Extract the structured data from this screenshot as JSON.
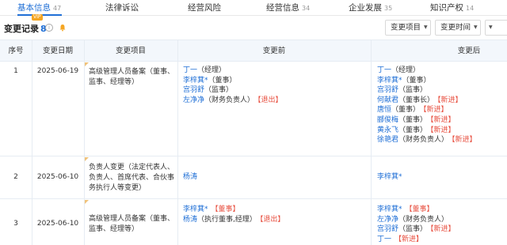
{
  "tabs": [
    {
      "label": "基本信息",
      "count": "47",
      "active": true
    },
    {
      "label": "法律诉讼",
      "count": "",
      "active": false
    },
    {
      "label": "经营风险",
      "count": "",
      "active": false
    },
    {
      "label": "经营信息",
      "count": "34",
      "active": false
    },
    {
      "label": "企业发展",
      "count": "35",
      "active": false
    },
    {
      "label": "知识产权",
      "count": "14",
      "active": false
    }
  ],
  "vip_badge": "VIP",
  "section": {
    "title": "变更记录",
    "count": "8"
  },
  "filters": {
    "item_label": "变更项目",
    "time_label": "变更时间"
  },
  "table": {
    "headers": [
      "序号",
      "变更日期",
      "变更项目",
      "变更前",
      "变更后"
    ],
    "rows": [
      {
        "index": "1",
        "date": "2025-06-19",
        "item": [
          "高级管理人员备案（董事、",
          "监事、经理等）"
        ],
        "before": [
          {
            "name": "丁一",
            "role": "（经理）",
            "tag": ""
          },
          {
            "name": "李梓萁*",
            "role": "（董事）",
            "tag": ""
          },
          {
            "name": "宫羽舒",
            "role": "（监事）",
            "tag": ""
          },
          {
            "name": "左净净",
            "role": "（财务负责人）",
            "tag": "【退出】"
          }
        ],
        "after": [
          {
            "name": "丁一",
            "role": "（经理）",
            "tag": ""
          },
          {
            "name": "李梓萁*",
            "role": "（董事）",
            "tag": ""
          },
          {
            "name": "宫羽舒",
            "role": "（监事）",
            "tag": ""
          },
          {
            "name": "何献君",
            "role": "（董事长）",
            "tag": "【新进】"
          },
          {
            "name": "唐恒",
            "role": "（董事）",
            "tag": "【新进】"
          },
          {
            "name": "郦俊梅",
            "role": "（董事）",
            "tag": "【新进】"
          },
          {
            "name": "黄永飞",
            "role": "（董事）",
            "tag": "【新进】"
          },
          {
            "name": "徐艳君",
            "role": "（财务负责人）",
            "tag": "【新进】"
          }
        ]
      },
      {
        "index": "2",
        "date": "2025-06-10",
        "item": [
          "负责人变更（法定代表人、",
          "负责人、首席代表、合伙事",
          "务执行人等变更）"
        ],
        "before": [
          {
            "name": "杨涛",
            "role": "",
            "tag": ""
          }
        ],
        "after": [
          {
            "name": "李梓萁*",
            "role": "",
            "tag": ""
          }
        ]
      },
      {
        "index": "3",
        "date": "2025-06-10",
        "item": [
          "高级管理人员备案（董事、",
          "监事、经理等）"
        ],
        "before": [
          {
            "name": "李梓萁*",
            "role": "",
            "tag": "【董事】"
          },
          {
            "name": "杨涛",
            "role": "（执行董事,经理）",
            "tag": "【退出】"
          }
        ],
        "after": [
          {
            "name": "李梓萁*",
            "role": "",
            "tag": "【董事】"
          },
          {
            "name": "左净净",
            "role": "（财务负责人）",
            "tag": ""
          },
          {
            "name": "宫羽舒",
            "role": "（监事）",
            "tag": "【新进】"
          },
          {
            "name": "丁一",
            "role": "",
            "tag": "【新进】"
          }
        ]
      }
    ]
  },
  "colors": {
    "link": "#1f6fd6",
    "tag": "#e74c3c",
    "header_bg": "#f3f7fc",
    "vip": "#f5a623"
  }
}
